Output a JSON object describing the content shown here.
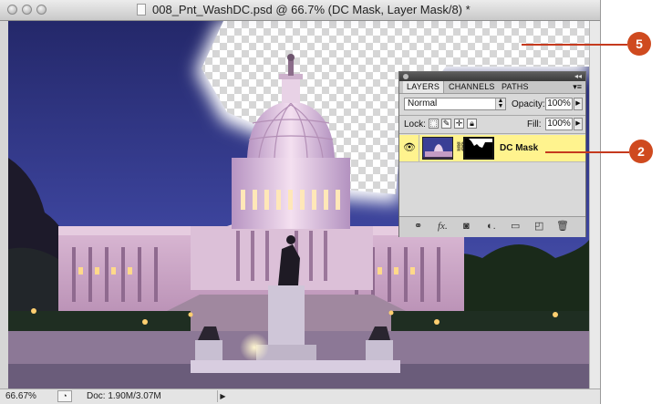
{
  "window": {
    "title": "008_Pnt_WashDC.psd @ 66.7% (DC Mask, Layer Mask/8) *"
  },
  "statusbar": {
    "zoom": "66.67%",
    "doc_size": "Doc: 1.90M/3.07M"
  },
  "layers_panel": {
    "tabs": [
      "LAYERS",
      "CHANNELS",
      "PATHS"
    ],
    "active_tab": "LAYERS",
    "blend_mode": "Normal",
    "opacity_label": "Opacity:",
    "opacity_value": "100%",
    "lock_label": "Lock:",
    "fill_label": "Fill:",
    "fill_value": "100%",
    "layers": [
      {
        "name": "DC Mask",
        "visible": true,
        "selected": true,
        "has_mask": true
      }
    ],
    "footer_icons": [
      "link-layers-icon",
      "fx-icon",
      "add-mask-icon",
      "adjustment-layer-icon",
      "new-group-icon",
      "new-layer-icon",
      "trash-icon"
    ]
  },
  "callouts": [
    {
      "number": "5"
    },
    {
      "number": "2"
    }
  ],
  "colors": {
    "callout": "#cf4a1f",
    "selected_layer": "#fff38e",
    "sky": "#3b3f8f"
  }
}
